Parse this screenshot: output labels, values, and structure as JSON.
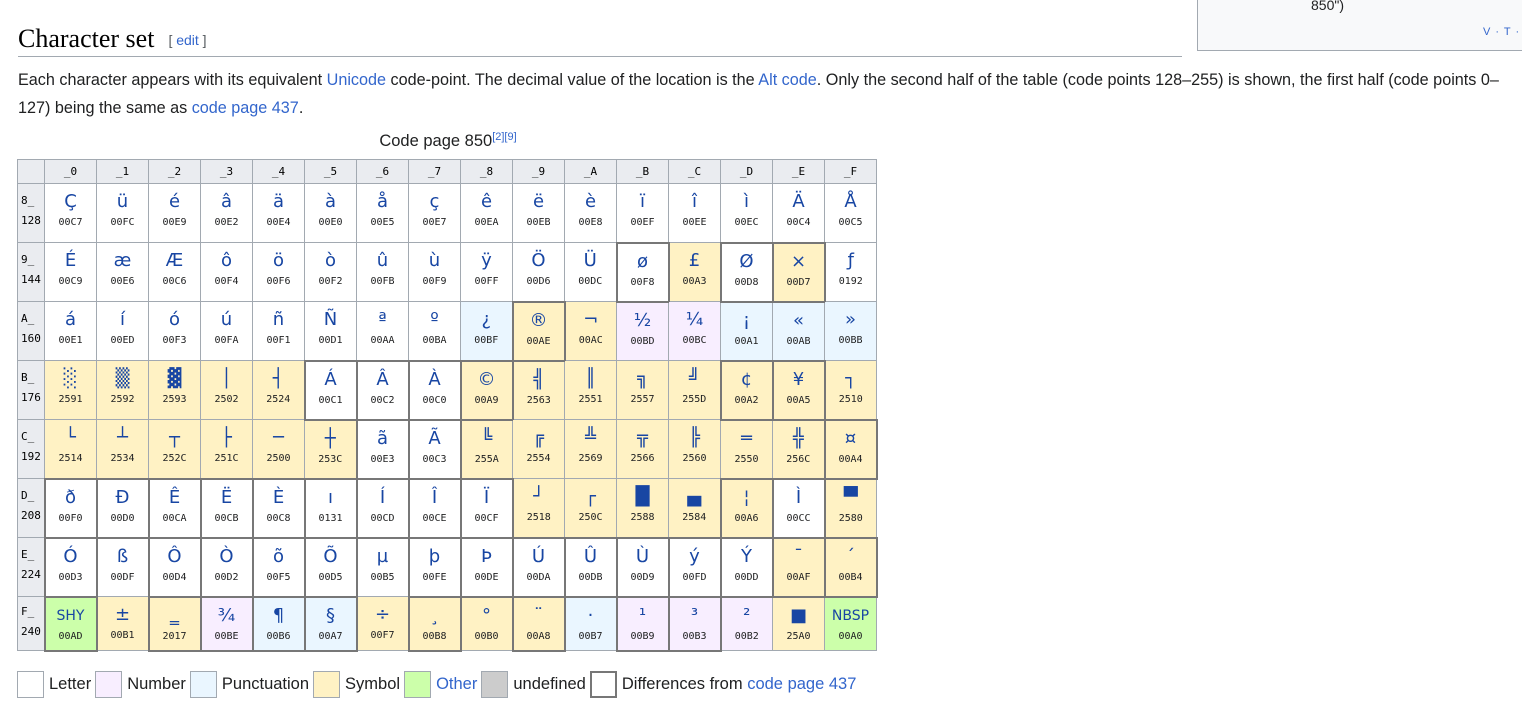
{
  "infobox": {
    "tail_text": "850\")",
    "vte": "V · T · E"
  },
  "heading": {
    "title": "Character set",
    "edit_open": "[ ",
    "edit_label": "edit",
    "edit_close": " ]"
  },
  "intro": {
    "t1": "Each character appears with its equivalent ",
    "link_unicode": "Unicode",
    "t2": " code-point. The decimal value of the location is the ",
    "link_alt": "Alt code",
    "t3": ". Only the second half of the table (code points 128–255) is shown, the first half (code points 0–127) being the same as ",
    "link_cp437": "code page 437",
    "t4": "."
  },
  "caption": {
    "text": "Code page 850",
    "refs": "[2][9]"
  },
  "columns": [
    "_0",
    "_1",
    "_2",
    "_3",
    "_4",
    "_5",
    "_6",
    "_7",
    "_8",
    "_9",
    "_A",
    "_B",
    "_C",
    "_D",
    "_E",
    "_F"
  ],
  "rows": [
    {
      "hex": "8_",
      "dec": "128",
      "cells": [
        {
          "g": "Ç",
          "c": "00C7",
          "t": "L"
        },
        {
          "g": "ü",
          "c": "00FC",
          "t": "L"
        },
        {
          "g": "é",
          "c": "00E9",
          "t": "L"
        },
        {
          "g": "â",
          "c": "00E2",
          "t": "L"
        },
        {
          "g": "ä",
          "c": "00E4",
          "t": "L"
        },
        {
          "g": "à",
          "c": "00E0",
          "t": "L"
        },
        {
          "g": "å",
          "c": "00E5",
          "t": "L"
        },
        {
          "g": "ç",
          "c": "00E7",
          "t": "L"
        },
        {
          "g": "ê",
          "c": "00EA",
          "t": "L"
        },
        {
          "g": "ë",
          "c": "00EB",
          "t": "L"
        },
        {
          "g": "è",
          "c": "00E8",
          "t": "L"
        },
        {
          "g": "ï",
          "c": "00EF",
          "t": "L"
        },
        {
          "g": "î",
          "c": "00EE",
          "t": "L"
        },
        {
          "g": "ì",
          "c": "00EC",
          "t": "L"
        },
        {
          "g": "Ä",
          "c": "00C4",
          "t": "L"
        },
        {
          "g": "Å",
          "c": "00C5",
          "t": "L"
        }
      ]
    },
    {
      "hex": "9_",
      "dec": "144",
      "cells": [
        {
          "g": "É",
          "c": "00C9",
          "t": "L"
        },
        {
          "g": "æ",
          "c": "00E6",
          "t": "L"
        },
        {
          "g": "Æ",
          "c": "00C6",
          "t": "L"
        },
        {
          "g": "ô",
          "c": "00F4",
          "t": "L"
        },
        {
          "g": "ö",
          "c": "00F6",
          "t": "L"
        },
        {
          "g": "ò",
          "c": "00F2",
          "t": "L"
        },
        {
          "g": "û",
          "c": "00FB",
          "t": "L"
        },
        {
          "g": "ù",
          "c": "00F9",
          "t": "L"
        },
        {
          "g": "ÿ",
          "c": "00FF",
          "t": "L"
        },
        {
          "g": "Ö",
          "c": "00D6",
          "t": "L"
        },
        {
          "g": "Ü",
          "c": "00DC",
          "t": "L"
        },
        {
          "g": "ø",
          "c": "00F8",
          "t": "L",
          "d": 1
        },
        {
          "g": "£",
          "c": "00A3",
          "t": "S"
        },
        {
          "g": "Ø",
          "c": "00D8",
          "t": "L",
          "d": 1
        },
        {
          "g": "×",
          "c": "00D7",
          "t": "S",
          "d": 1
        },
        {
          "g": "ƒ",
          "c": "0192",
          "t": "L"
        }
      ]
    },
    {
      "hex": "A_",
      "dec": "160",
      "cells": [
        {
          "g": "á",
          "c": "00E1",
          "t": "L"
        },
        {
          "g": "í",
          "c": "00ED",
          "t": "L"
        },
        {
          "g": "ó",
          "c": "00F3",
          "t": "L"
        },
        {
          "g": "ú",
          "c": "00FA",
          "t": "L"
        },
        {
          "g": "ñ",
          "c": "00F1",
          "t": "L"
        },
        {
          "g": "Ñ",
          "c": "00D1",
          "t": "L"
        },
        {
          "g": "ª",
          "c": "00AA",
          "t": "L"
        },
        {
          "g": "º",
          "c": "00BA",
          "t": "L"
        },
        {
          "g": "¿",
          "c": "00BF",
          "t": "P"
        },
        {
          "g": "®",
          "c": "00AE",
          "t": "S",
          "d": 1
        },
        {
          "g": "¬",
          "c": "00AC",
          "t": "S"
        },
        {
          "g": "½",
          "c": "00BD",
          "t": "N"
        },
        {
          "g": "¼",
          "c": "00BC",
          "t": "N"
        },
        {
          "g": "¡",
          "c": "00A1",
          "t": "P"
        },
        {
          "g": "«",
          "c": "00AB",
          "t": "P"
        },
        {
          "g": "»",
          "c": "00BB",
          "t": "P"
        }
      ]
    },
    {
      "hex": "B_",
      "dec": "176",
      "cells": [
        {
          "g": "░",
          "c": "2591",
          "t": "S"
        },
        {
          "g": "▒",
          "c": "2592",
          "t": "S"
        },
        {
          "g": "▓",
          "c": "2593",
          "t": "S"
        },
        {
          "g": "│",
          "c": "2502",
          "t": "S"
        },
        {
          "g": "┤",
          "c": "2524",
          "t": "S"
        },
        {
          "g": "Á",
          "c": "00C1",
          "t": "L",
          "d": 1
        },
        {
          "g": "Â",
          "c": "00C2",
          "t": "L",
          "d": 1
        },
        {
          "g": "À",
          "c": "00C0",
          "t": "L",
          "d": 1
        },
        {
          "g": "©",
          "c": "00A9",
          "t": "S",
          "d": 1
        },
        {
          "g": "╣",
          "c": "2563",
          "t": "S"
        },
        {
          "g": "║",
          "c": "2551",
          "t": "S"
        },
        {
          "g": "╗",
          "c": "2557",
          "t": "S"
        },
        {
          "g": "╝",
          "c": "255D",
          "t": "S"
        },
        {
          "g": "¢",
          "c": "00A2",
          "t": "S",
          "d": 1
        },
        {
          "g": "¥",
          "c": "00A5",
          "t": "S",
          "d": 1
        },
        {
          "g": "┐",
          "c": "2510",
          "t": "S"
        }
      ]
    },
    {
      "hex": "C_",
      "dec": "192",
      "cells": [
        {
          "g": "└",
          "c": "2514",
          "t": "S"
        },
        {
          "g": "┴",
          "c": "2534",
          "t": "S"
        },
        {
          "g": "┬",
          "c": "252C",
          "t": "S"
        },
        {
          "g": "├",
          "c": "251C",
          "t": "S"
        },
        {
          "g": "─",
          "c": "2500",
          "t": "S"
        },
        {
          "g": "┼",
          "c": "253C",
          "t": "S"
        },
        {
          "g": "ã",
          "c": "00E3",
          "t": "L",
          "d": 1
        },
        {
          "g": "Ã",
          "c": "00C3",
          "t": "L",
          "d": 1
        },
        {
          "g": "╚",
          "c": "255A",
          "t": "S"
        },
        {
          "g": "╔",
          "c": "2554",
          "t": "S"
        },
        {
          "g": "╩",
          "c": "2569",
          "t": "S"
        },
        {
          "g": "╦",
          "c": "2566",
          "t": "S"
        },
        {
          "g": "╠",
          "c": "2560",
          "t": "S"
        },
        {
          "g": "═",
          "c": "2550",
          "t": "S"
        },
        {
          "g": "╬",
          "c": "256C",
          "t": "S"
        },
        {
          "g": "¤",
          "c": "00A4",
          "t": "S",
          "d": 1
        }
      ]
    },
    {
      "hex": "D_",
      "dec": "208",
      "cells": [
        {
          "g": "ð",
          "c": "00F0",
          "t": "L",
          "d": 1
        },
        {
          "g": "Đ",
          "c": "00D0",
          "t": "L",
          "d": 1
        },
        {
          "g": "Ê",
          "c": "00CA",
          "t": "L",
          "d": 1
        },
        {
          "g": "Ë",
          "c": "00CB",
          "t": "L",
          "d": 1
        },
        {
          "g": "È",
          "c": "00C8",
          "t": "L",
          "d": 1
        },
        {
          "g": "ı",
          "c": "0131",
          "t": "L",
          "d": 1
        },
        {
          "g": "Í",
          "c": "00CD",
          "t": "L",
          "d": 1
        },
        {
          "g": "Î",
          "c": "00CE",
          "t": "L",
          "d": 1
        },
        {
          "g": "Ï",
          "c": "00CF",
          "t": "L",
          "d": 1
        },
        {
          "g": "┘",
          "c": "2518",
          "t": "S"
        },
        {
          "g": "┌",
          "c": "250C",
          "t": "S"
        },
        {
          "g": "█",
          "c": "2588",
          "t": "S"
        },
        {
          "g": "▄",
          "c": "2584",
          "t": "S"
        },
        {
          "g": "¦",
          "c": "00A6",
          "t": "S",
          "d": 1
        },
        {
          "g": "Ì",
          "c": "00CC",
          "t": "L",
          "d": 1
        },
        {
          "g": "▀",
          "c": "2580",
          "t": "S"
        }
      ]
    },
    {
      "hex": "E_",
      "dec": "224",
      "cells": [
        {
          "g": "Ó",
          "c": "00D3",
          "t": "L",
          "d": 1
        },
        {
          "g": "ß",
          "c": "00DF",
          "t": "L"
        },
        {
          "g": "Ô",
          "c": "00D4",
          "t": "L",
          "d": 1
        },
        {
          "g": "Ò",
          "c": "00D2",
          "t": "L",
          "d": 1
        },
        {
          "g": "õ",
          "c": "00F5",
          "t": "L",
          "d": 1
        },
        {
          "g": "Õ",
          "c": "00D5",
          "t": "L",
          "d": 1
        },
        {
          "g": "µ",
          "c": "00B5",
          "t": "L"
        },
        {
          "g": "þ",
          "c": "00FE",
          "t": "L",
          "d": 1
        },
        {
          "g": "Þ",
          "c": "00DE",
          "t": "L",
          "d": 1
        },
        {
          "g": "Ú",
          "c": "00DA",
          "t": "L",
          "d": 1
        },
        {
          "g": "Û",
          "c": "00DB",
          "t": "L",
          "d": 1
        },
        {
          "g": "Ù",
          "c": "00D9",
          "t": "L",
          "d": 1
        },
        {
          "g": "ý",
          "c": "00FD",
          "t": "L",
          "d": 1
        },
        {
          "g": "Ý",
          "c": "00DD",
          "t": "L",
          "d": 1
        },
        {
          "g": "¯",
          "c": "00AF",
          "t": "S",
          "d": 1
        },
        {
          "g": "´",
          "c": "00B4",
          "t": "S",
          "d": 1
        }
      ]
    },
    {
      "hex": "F_",
      "dec": "240",
      "cells": [
        {
          "g": "SHY",
          "c": "00AD",
          "t": "O",
          "d": 1,
          "sm": 1
        },
        {
          "g": "±",
          "c": "00B1",
          "t": "S"
        },
        {
          "g": "‗",
          "c": "2017",
          "t": "S",
          "d": 1
        },
        {
          "g": "¾",
          "c": "00BE",
          "t": "N",
          "d": 1
        },
        {
          "g": "¶",
          "c": "00B6",
          "t": "P",
          "d": 1
        },
        {
          "g": "§",
          "c": "00A7",
          "t": "P",
          "d": 1
        },
        {
          "g": "÷",
          "c": "00F7",
          "t": "S"
        },
        {
          "g": "¸",
          "c": "00B8",
          "t": "S",
          "d": 1
        },
        {
          "g": "°",
          "c": "00B0",
          "t": "S"
        },
        {
          "g": "¨",
          "c": "00A8",
          "t": "S",
          "d": 1
        },
        {
          "g": "·",
          "c": "00B7",
          "t": "P"
        },
        {
          "g": "¹",
          "c": "00B9",
          "t": "N",
          "d": 1
        },
        {
          "g": "³",
          "c": "00B3",
          "t": "N",
          "d": 1
        },
        {
          "g": "²",
          "c": "00B2",
          "t": "N"
        },
        {
          "g": "■",
          "c": "25A0",
          "t": "S"
        },
        {
          "g": "NBSP",
          "c": "00A0",
          "t": "O",
          "sm": 1
        }
      ]
    }
  ],
  "legend": {
    "letter": "Letter",
    "number": "Number",
    "punctuation": "Punctuation",
    "symbol": "Symbol",
    "other": "Other",
    "undefined": "undefined",
    "diff_prefix": "Differences from ",
    "diff_link": "code page 437"
  },
  "colors": {
    "letter": "#ffffff",
    "number": "#f8eeff",
    "punctuation": "#eaf6ff",
    "symbol": "#fff2c4",
    "other": "#ccffaa",
    "undefined": "#cccccc",
    "link": "#3366cc",
    "glyph": "#1846a3"
  }
}
